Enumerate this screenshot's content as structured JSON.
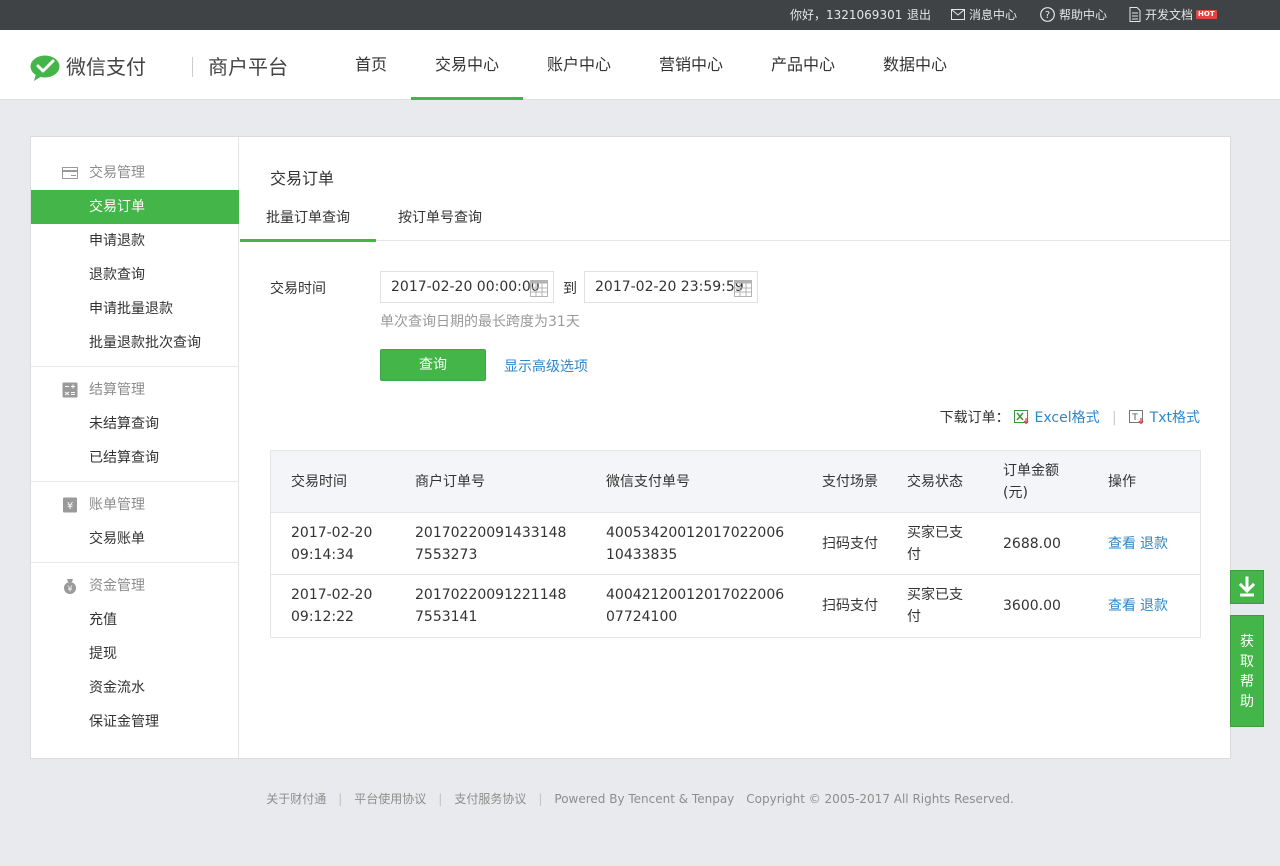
{
  "topbar": {
    "greeting": "你好，1321069301",
    "logout": "退出",
    "messages": "消息中心",
    "help": "帮助中心",
    "docs": "开发文档",
    "hot_badge": "HOT"
  },
  "header": {
    "logo_text": "微信支付",
    "logo_sub": "商户平台",
    "nav": [
      "首页",
      "交易中心",
      "账户中心",
      "营销中心",
      "产品中心",
      "数据中心"
    ],
    "active_nav": "交易中心"
  },
  "sidebar": {
    "groups": [
      {
        "title": "交易管理",
        "icon": "transaction-icon",
        "items": [
          "交易订单",
          "申请退款",
          "退款查询",
          "申请批量退款",
          "批量退款批次查询"
        ]
      },
      {
        "title": "结算管理",
        "icon": "calculator-icon",
        "items": [
          "未结算查询",
          "已结算查询"
        ]
      },
      {
        "title": "账单管理",
        "icon": "bill-icon",
        "items": [
          "交易账单"
        ]
      },
      {
        "title": "资金管理",
        "icon": "money-bag-icon",
        "items": [
          "充值",
          "提现",
          "资金流水",
          "保证金管理"
        ]
      }
    ],
    "active_item": "交易订单"
  },
  "main": {
    "title": "交易订单",
    "tabs": [
      "批量订单查询",
      "按订单号查询"
    ],
    "active_tab": "批量订单查询",
    "time_label": "交易时间",
    "start_time": "2017-02-20 00:00:00",
    "to_text": "到",
    "end_time": "2017-02-20 23:59:59",
    "hint": "单次查询日期的最长跨度为31天",
    "query_button": "查询",
    "advanced_link": "显示高级选项",
    "download_label": "下载订单：",
    "excel_link": "Excel格式",
    "txt_link": "Txt格式"
  },
  "table": {
    "headers": [
      "交易时间",
      "商户订单号",
      "微信支付单号",
      "支付场景",
      "交易状态",
      "订单金额(元)",
      "操作"
    ],
    "rows": [
      {
        "time": "2017-02-20 09:14:34",
        "merchant_no": "201702200914331487553273",
        "wx_no": "4005342001201702200610433835",
        "scene": "扫码支付",
        "status": "买家已支付",
        "amount": "2688.00",
        "ops": [
          "查看",
          "退款"
        ]
      },
      {
        "time": "2017-02-20 09:12:22",
        "merchant_no": "201702200912211487553141",
        "wx_no": "4004212001201702200607724100",
        "scene": "扫码支付",
        "status": "买家已支付",
        "amount": "3600.00",
        "ops": [
          "查看",
          "退款"
        ]
      }
    ]
  },
  "float": {
    "help_text": "获取帮助"
  },
  "footer": {
    "links": [
      "关于财付通",
      "平台使用协议",
      "支付服务协议"
    ],
    "powered": "Powered By Tencent & Tenpay",
    "copyright": "Copyright © 2005-2017 All Rights Reserved."
  },
  "colors": {
    "accent": "#44b549",
    "link": "#2f87c8",
    "topbar_bg": "#3f4346",
    "page_bg": "#e9eaed"
  }
}
